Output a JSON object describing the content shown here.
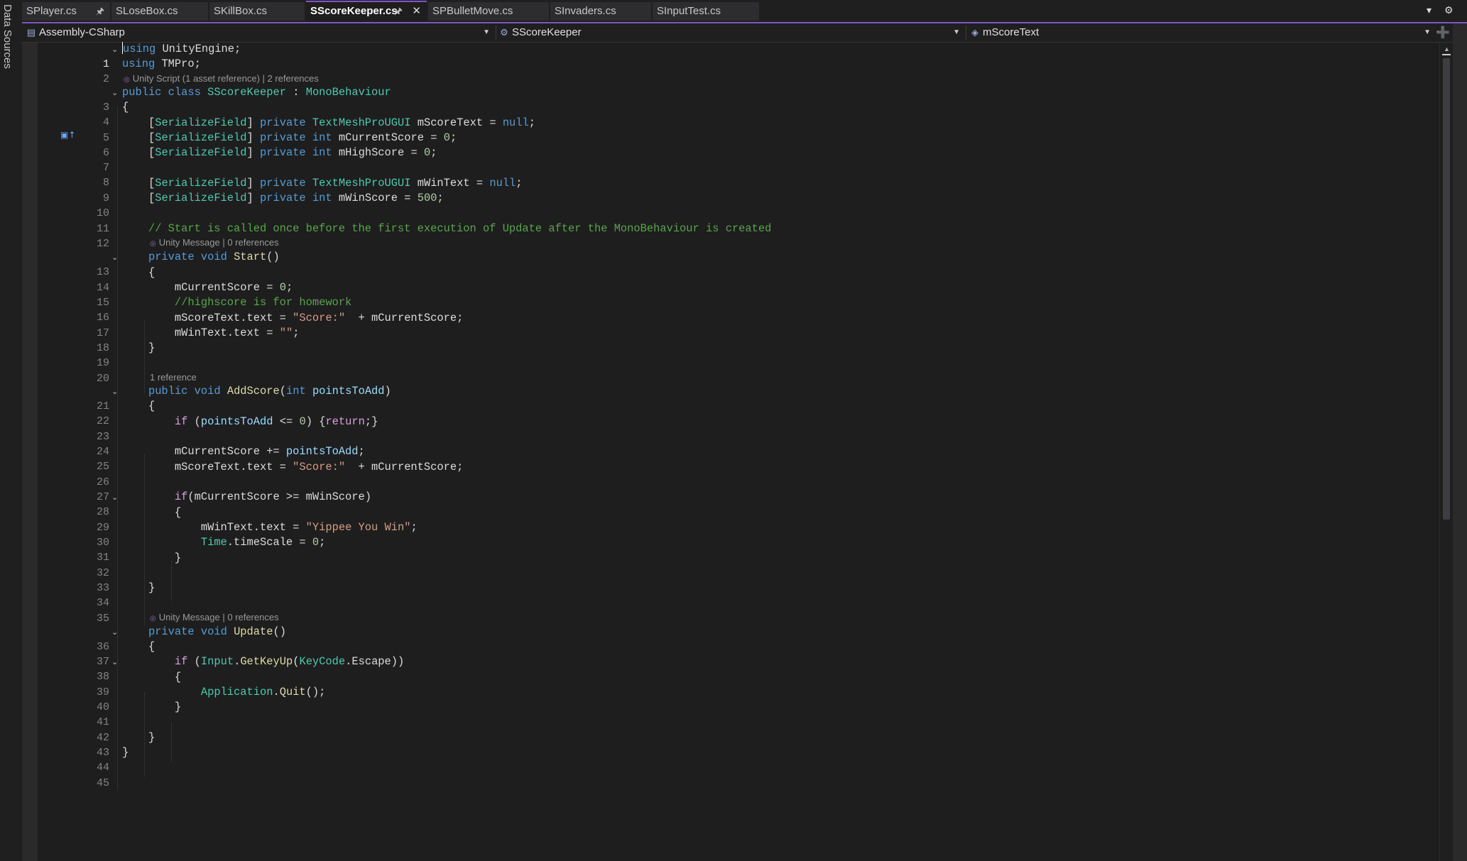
{
  "sidebar": {
    "label": "Data Sources"
  },
  "tabs": [
    {
      "label": "SPlayer.cs",
      "active": false,
      "pinned": true
    },
    {
      "label": "SLoseBox.cs",
      "active": false,
      "pinned": false
    },
    {
      "label": "SKillBox.cs",
      "active": false,
      "pinned": false
    },
    {
      "label": "SScoreKeeper.cs",
      "active": true,
      "pinned": true
    },
    {
      "label": "SPBulletMove.cs",
      "active": false,
      "pinned": false
    },
    {
      "label": "SInvaders.cs",
      "active": false,
      "pinned": false
    },
    {
      "label": "SInputTest.cs",
      "active": false,
      "pinned": false
    }
  ],
  "nav": {
    "project": "Assembly-CSharp",
    "type": "SScoreKeeper",
    "member": "mScoreText"
  },
  "lenses": {
    "class": "Unity Script (1 asset reference) | 2 references",
    "start": "Unity Message | 0 references",
    "addscore": "1 reference",
    "update": "Unity Message | 0 references"
  },
  "code": {
    "l1": [
      "using",
      "UnityEngine;"
    ],
    "l2": [
      "using",
      "TMPro;"
    ],
    "l3": [
      "public",
      "class",
      "SScoreKeeper",
      ":",
      "MonoBehaviour"
    ],
    "l4": "{",
    "l5": [
      "[",
      "SerializeField",
      "]",
      "private",
      "TextMeshProUGUI",
      "mScoreText =",
      "null",
      ";"
    ],
    "l6": [
      "[",
      "SerializeField",
      "]",
      "private",
      "int",
      "mCurrentScore =",
      "0",
      ";"
    ],
    "l7": [
      "[",
      "SerializeField",
      "]",
      "private",
      "int",
      "mHighScore =",
      "0",
      ";"
    ],
    "l9": [
      "[",
      "SerializeField",
      "]",
      "private",
      "TextMeshProUGUI",
      "mWinText =",
      "null",
      ";"
    ],
    "l10": [
      "[",
      "SerializeField",
      "]",
      "private",
      "int",
      "mWinScore =",
      "500",
      ";"
    ],
    "l12": "// Start is called once before the first execution of Update after the MonoBehaviour is created",
    "l13": [
      "private",
      "void",
      "Start",
      "()"
    ],
    "l14": "{",
    "l15": [
      "mCurrentScore =",
      "0",
      ";"
    ],
    "l16": "//highscore is for homework",
    "l17": [
      "mScoreText",
      ".",
      "text =",
      "\"Score:\"",
      "+ mCurrentScore;"
    ],
    "l18": [
      "mWinText",
      ".",
      "text =",
      "\"\"",
      ";"
    ],
    "l19": "}",
    "l21": [
      "public",
      "void",
      "AddScore",
      "(",
      "int",
      "pointsToAdd",
      ")"
    ],
    "l22": "{",
    "l23": [
      "if",
      "(",
      "pointsToAdd",
      "<=",
      "0",
      ") {",
      "return",
      ";}"
    ],
    "l25": [
      "mCurrentScore +=",
      "pointsToAdd",
      ";"
    ],
    "l26": [
      "mScoreText",
      ".",
      "text =",
      "\"Score:\"",
      "+ mCurrentScore;"
    ],
    "l28": [
      "if",
      "(mCurrentScore >= mWinScore)"
    ],
    "l29": "{",
    "l30": [
      "mWinText",
      ".",
      "text =",
      "\"Yippee You Win\"",
      ";"
    ],
    "l31": [
      "Time",
      ".",
      "timeScale =",
      "0",
      ";"
    ],
    "l32": "}",
    "l34": "}",
    "l36": [
      "private",
      "void",
      "Update",
      "()"
    ],
    "l37": "{",
    "l38": [
      "if",
      "(",
      "Input",
      ".",
      "GetKeyUp",
      "(",
      "KeyCode",
      ".",
      "Escape",
      "))"
    ],
    "l39": "{",
    "l40": [
      "Application",
      ".",
      "Quit",
      "();"
    ],
    "l41": "}",
    "l43": "}",
    "l44": "}"
  },
  "line_numbers": [
    "1",
    "2",
    "3",
    "4",
    "5",
    "6",
    "7",
    "8",
    "9",
    "10",
    "11",
    "12",
    "13",
    "14",
    "15",
    "16",
    "17",
    "18",
    "19",
    "20",
    "21",
    "22",
    "23",
    "24",
    "25",
    "26",
    "27",
    "28",
    "29",
    "30",
    "31",
    "32",
    "33",
    "34",
    "35",
    "36",
    "37",
    "38",
    "39",
    "40",
    "41",
    "42",
    "43",
    "44",
    "45"
  ],
  "colors": {
    "keyword": "#569cd6",
    "control": "#d8a0df",
    "type": "#4ec9b0",
    "string": "#d69d85",
    "number": "#b5cea8",
    "comment": "#57a64a",
    "method": "#dcdcaa",
    "parameter": "#9cdcfe",
    "accent": "#7e57c2"
  },
  "icons": {
    "pin": "pin-icon",
    "close": "close-icon",
    "dropdown": "chevron-down-icon",
    "settings": "gear-icon",
    "fold": "collapse-icon"
  }
}
